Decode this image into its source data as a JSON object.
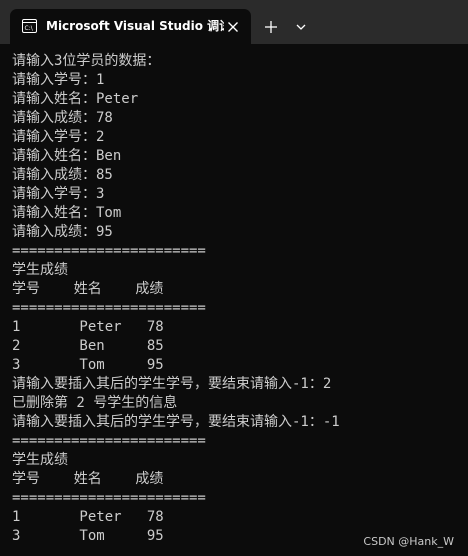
{
  "tab": {
    "title": "Microsoft Visual Studio 调试控",
    "icon": "terminal-icon",
    "close_icon": "close-icon"
  },
  "tabbar": {
    "new_tab_icon": "plus-icon",
    "dropdown_icon": "chevron-down-icon"
  },
  "console": {
    "lines": [
      "请输入3位学员的数据：",
      "请输入学号：1",
      "请输入姓名：Peter",
      "请输入成绩：78",
      "请输入学号：2",
      "请输入姓名：Ben",
      "请输入成绩：85",
      "请输入学号：3",
      "请输入姓名：Tom",
      "请输入成绩：95",
      "=======================",
      "学生成绩",
      "学号    姓名    成绩",
      "=======================",
      "1       Peter   78",
      "2       Ben     85",
      "3       Tom     95",
      "请输入要插入其后的学生学号，要结束请输入-1：2",
      "已删除第 2 号学生的信息",
      "请输入要插入其后的学生学号，要结束请输入-1：-1",
      "=======================",
      "学生成绩",
      "学号    姓名    成绩",
      "=======================",
      "1       Peter   78",
      "3       Tom     95"
    ]
  },
  "watermark": "CSDN @Hank_W",
  "colors": {
    "background": "#0c0c0c",
    "tabbar": "#2b2b2b",
    "text": "#cccccc"
  }
}
